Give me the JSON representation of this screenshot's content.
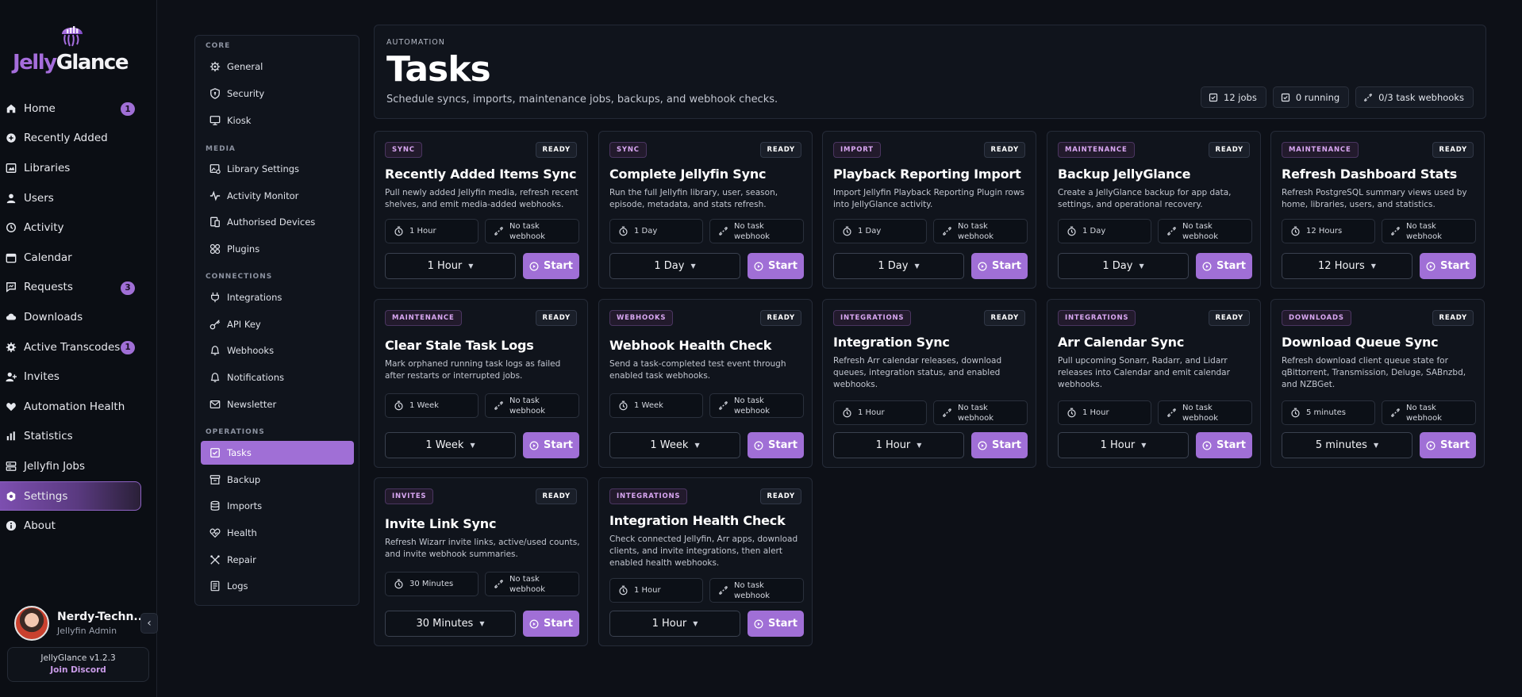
{
  "brand": {
    "part1": "Jelly",
    "part2": "Glance"
  },
  "nav": {
    "items": [
      {
        "label": "Home",
        "icon": "home-icon",
        "badge": "1"
      },
      {
        "label": "Recently Added",
        "icon": "sparkle-icon"
      },
      {
        "label": "Libraries",
        "icon": "library-icon"
      },
      {
        "label": "Users",
        "icon": "user-icon"
      },
      {
        "label": "Activity",
        "icon": "history-icon"
      },
      {
        "label": "Calendar",
        "icon": "calendar-icon"
      },
      {
        "label": "Requests",
        "icon": "message-icon",
        "badge": "3"
      },
      {
        "label": "Downloads",
        "icon": "cloud-download-icon"
      },
      {
        "label": "Active Transcodes",
        "icon": "cog-icon",
        "badge": "1"
      },
      {
        "label": "Invites",
        "icon": "user-plus-icon"
      },
      {
        "label": "Automation Health",
        "icon": "heart-pulse-icon"
      },
      {
        "label": "Statistics",
        "icon": "bar-chart-icon"
      },
      {
        "label": "Jellyfin Jobs",
        "icon": "server-icon"
      },
      {
        "label": "Settings",
        "icon": "settings-icon",
        "active": true
      },
      {
        "label": "About",
        "icon": "info-icon"
      }
    ]
  },
  "profile": {
    "name": "Nerdy-Techn...",
    "role": "Jellyfin Admin"
  },
  "footer": {
    "version": "JellyGlance v1.2.3",
    "discord": "Join Discord"
  },
  "settings_nav": {
    "core": "CORE",
    "media": "MEDIA",
    "connections": "CONNECTIONS",
    "operations": "OPERATIONS",
    "items": {
      "general": "General",
      "security": "Security",
      "kiosk": "Kiosk",
      "library_settings": "Library Settings",
      "activity_monitor": "Activity Monitor",
      "authorised_devices": "Authorised Devices",
      "plugins": "Plugins",
      "integrations": "Integrations",
      "api_key": "API Key",
      "webhooks": "Webhooks",
      "notifications": "Notifications",
      "newsletter": "Newsletter",
      "tasks": "Tasks",
      "backup": "Backup",
      "imports": "Imports",
      "health": "Health",
      "repair": "Repair",
      "logs": "Logs"
    }
  },
  "header": {
    "eyebrow": "AUTOMATION",
    "title": "Tasks",
    "subtitle": "Schedule syncs, imports, maintenance jobs, backups, and webhook checks.",
    "chips": {
      "jobs": "12 jobs",
      "running": "0 running",
      "webhooks": "0/3 task webhooks"
    }
  },
  "labels": {
    "ready": "READY",
    "no_webhook": "No task webhook",
    "start": "Start"
  },
  "tasks": [
    {
      "category": "SYNC",
      "title": "Recently Added Items Sync",
      "description": "Pull newly added Jellyfin media, refresh recent shelves, and emit media-added webhooks.",
      "interval": "1 Hour",
      "select": "1 Hour"
    },
    {
      "category": "SYNC",
      "title": "Complete Jellyfin Sync",
      "description": "Run the full Jellyfin library, user, season, episode, metadata, and stats refresh.",
      "interval": "1 Day",
      "select": "1 Day"
    },
    {
      "category": "IMPORT",
      "title": "Playback Reporting Import",
      "description": "Import Jellyfin Playback Reporting Plugin rows into JellyGlance activity.",
      "interval": "1 Day",
      "select": "1 Day"
    },
    {
      "category": "MAINTENANCE",
      "title": "Backup JellyGlance",
      "description": "Create a JellyGlance backup for app data, settings, and operational recovery.",
      "interval": "1 Day",
      "select": "1 Day"
    },
    {
      "category": "MAINTENANCE",
      "title": "Refresh Dashboard Stats",
      "description": "Refresh PostgreSQL summary views used by home, libraries, users, and statistics.",
      "interval": "12 Hours",
      "select": "12 Hours"
    },
    {
      "category": "MAINTENANCE",
      "title": "Clear Stale Task Logs",
      "description": "Mark orphaned running task logs as failed after restarts or interrupted jobs.",
      "interval": "1 Week",
      "select": "1 Week"
    },
    {
      "category": "WEBHOOKS",
      "title": "Webhook Health Check",
      "description": "Send a task-completed test event through enabled task webhooks.",
      "interval": "1 Week",
      "select": "1 Week"
    },
    {
      "category": "INTEGRATIONS",
      "title": "Integration Sync",
      "description": "Refresh Arr calendar releases, download queues, integration status, and enabled webhooks.",
      "interval": "1 Hour",
      "select": "1 Hour"
    },
    {
      "category": "INTEGRATIONS",
      "title": "Arr Calendar Sync",
      "description": "Pull upcoming Sonarr, Radarr, and Lidarr releases into Calendar and emit calendar webhooks.",
      "interval": "1 Hour",
      "select": "1 Hour"
    },
    {
      "category": "DOWNLOADS",
      "title": "Download Queue Sync",
      "description": "Refresh download client queue state for qBittorrent, Transmission, Deluge, SABnzbd, and NZBGet.",
      "interval": "5 minutes",
      "select": "5 minutes"
    },
    {
      "category": "INVITES",
      "title": "Invite Link Sync",
      "description": "Refresh Wizarr invite links, active/used counts, and invite webhook summaries.",
      "interval": "30 Minutes",
      "select": "30 Minutes"
    },
    {
      "category": "INTEGRATIONS",
      "title": "Integration Health Check",
      "description": "Check connected Jellyfin, Arr apps, download clients, and invite integrations, then alert enabled health webhooks.",
      "interval": "1 Hour",
      "select": "1 Hour"
    }
  ],
  "colors": {
    "accent": "#a06fd6",
    "background": "#0d1017",
    "panel": "#10141c"
  }
}
